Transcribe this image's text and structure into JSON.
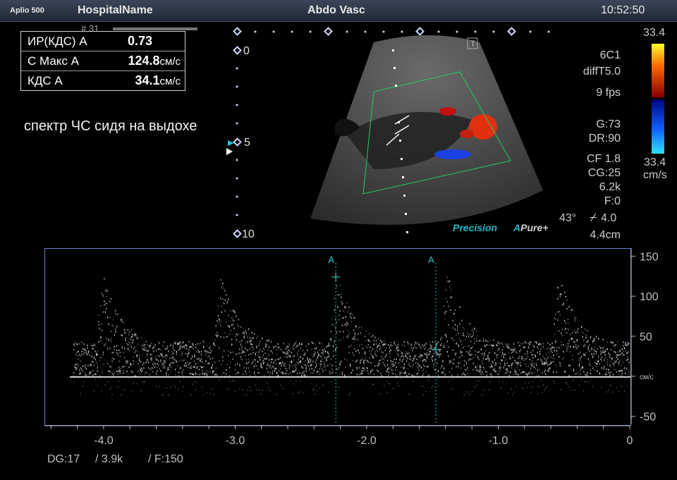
{
  "header": {
    "system": "Aplio 500",
    "hospital": "HospitalName",
    "preset": "Abdo Vasc",
    "time": "10:52:50",
    "frame_tag": "# 31"
  },
  "measurements": [
    {
      "label": "ИР(КДС) А",
      "value": "0.73",
      "unit": ""
    },
    {
      "label": "С Макс А",
      "value": "124.8",
      "unit": "см/с"
    },
    {
      "label": "КДС А",
      "value": "34.1",
      "unit": "см/с"
    }
  ],
  "annotation": "спектр ЧС сидя на выдохе",
  "depth_scale": [
    "0",
    "5",
    "10"
  ],
  "image_params": {
    "probe": "6C1",
    "filter": "diffT5.0",
    "fps": "9 fps",
    "gain": "G:73",
    "dr": "DR:90",
    "cf": "CF 1.8",
    "cg": "CG:25",
    "prf": "6.2k",
    "f": "F:0",
    "angle": "43°",
    "angle_corr": "4.0",
    "depth": "4.4cm",
    "precision": "Precision",
    "apure": "Pure+",
    "apure_prefix": "A",
    "t_marker": "T"
  },
  "color_bar": {
    "top": "33.4",
    "bottom": "33.4",
    "unit": "cm/s",
    "colors": {
      "top": "#ffff30",
      "mid_red": "#8a0000",
      "mid_blue": "#000a8a",
      "bottom": "#30e0ff"
    }
  },
  "doppler": {
    "velocity_ticks": [
      "150",
      "100",
      "50",
      "см/с",
      "-50"
    ],
    "velocity_values": [
      150,
      100,
      50,
      0,
      -50
    ],
    "time_ticks": [
      "-4.0",
      "-3.0",
      "-2.0",
      "-1.0",
      "0"
    ],
    "time_values": [
      -4.0,
      -3.0,
      -2.0,
      -1.0,
      0
    ],
    "cursor_label": "A",
    "cursors": [
      {
        "t": -2.24,
        "v": 124.8
      },
      {
        "t": -1.48,
        "v": 34.1
      }
    ],
    "peak_times": [
      -4.02,
      -3.12,
      -2.24,
      -1.4,
      -0.55
    ],
    "vmin": -60,
    "vmax": 160,
    "tmin": -4.45,
    "tmax": 0
  },
  "footer": {
    "dg": "DG:17",
    "prf": "/ 3.9k",
    "f": "/ F:150"
  }
}
